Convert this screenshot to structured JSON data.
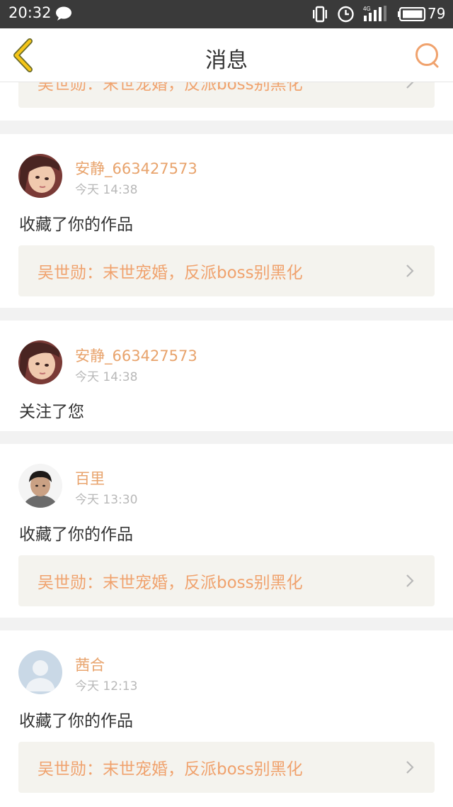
{
  "status_bar": {
    "time": "20:32",
    "battery_level": "79",
    "network_type": "4G",
    "icons": [
      "chat-bubble-icon",
      "vibrate-icon",
      "alarm-icon",
      "signal-icon",
      "battery-icon"
    ]
  },
  "header": {
    "title": "消息",
    "back_icon": "chevron-left-icon",
    "search_icon": "search-icon"
  },
  "colors": {
    "accent": "#e8a36c",
    "link_text": "#f0a26d",
    "link_bg": "#f4f3ee",
    "back_icon": "#f5c518"
  },
  "partial_item": {
    "work_title": "吴世勋：末世宠婚，反派boss别黑化"
  },
  "messages": [
    {
      "username": "安静_663427573",
      "time": "今天 14:38",
      "action": "收藏了你的作品",
      "work_title": "吴世勋：末世宠婚，反派boss别黑化"
    },
    {
      "username": "安静_663427573",
      "time": "今天 14:38",
      "action": "关注了您"
    },
    {
      "username": "百里",
      "time": "今天 13:30",
      "action": "收藏了你的作品",
      "work_title": "吴世勋：末世宠婚，反派boss别黑化"
    },
    {
      "username": "茜合",
      "time": "今天 12:13",
      "action": "收藏了你的作品",
      "work_title": "吴世勋：末世宠婚，反派boss别黑化"
    }
  ]
}
